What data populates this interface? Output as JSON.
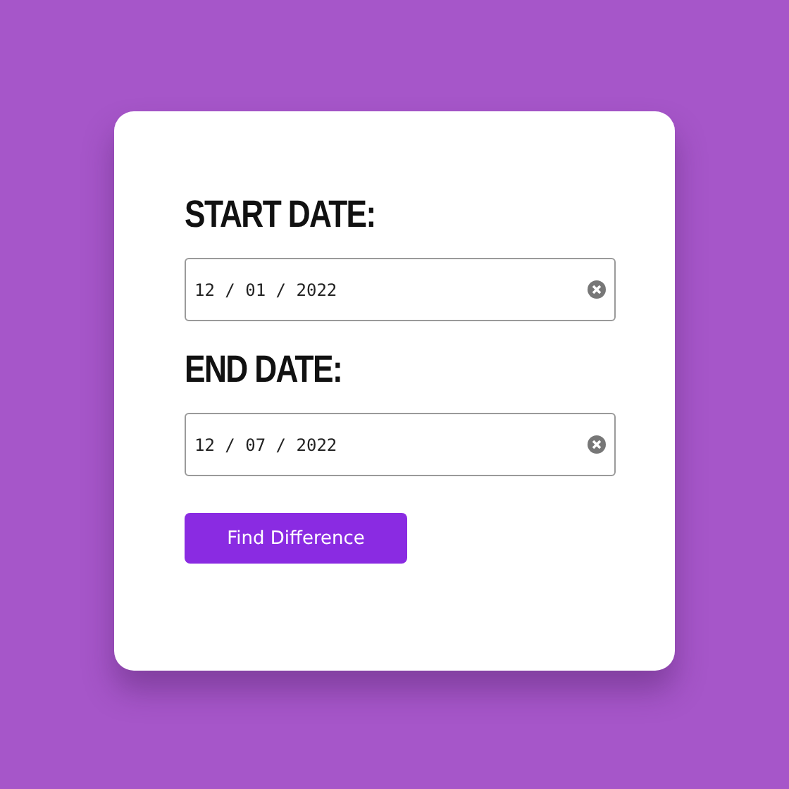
{
  "fields": [
    {
      "label": "START DATE:",
      "value": "12 / 01 / 2022"
    },
    {
      "label": "END DATE:",
      "value": "12 / 07 / 2022"
    }
  ],
  "button": {
    "label": "Find Difference"
  }
}
